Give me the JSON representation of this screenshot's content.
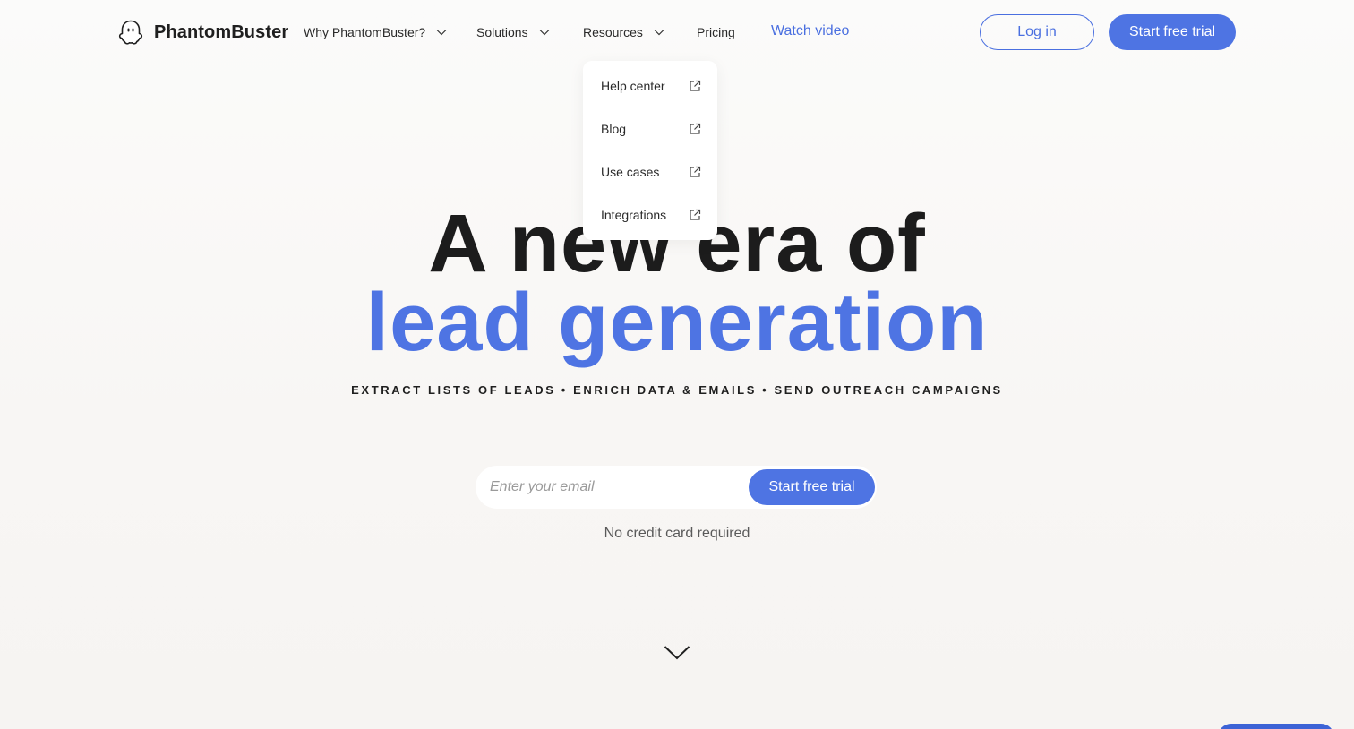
{
  "brand": {
    "name": "PhantomBuster",
    "icon": "ghost-logo-icon",
    "accent": "#4e74e3"
  },
  "nav": {
    "items": [
      {
        "label": "Why PhantomBuster?",
        "has_dropdown": true
      },
      {
        "label": "Solutions",
        "has_dropdown": true
      },
      {
        "label": "Resources",
        "has_dropdown": true
      },
      {
        "label": "Pricing",
        "has_dropdown": false
      }
    ],
    "watch_video": "Watch video",
    "login": "Log in",
    "start_trial": "Start free trial"
  },
  "resources_menu": {
    "items": [
      {
        "label": "Help center",
        "icon": "external-link-icon"
      },
      {
        "label": "Blog",
        "icon": "external-link-icon"
      },
      {
        "label": "Use cases",
        "icon": "external-link-icon"
      },
      {
        "label": "Integrations",
        "icon": "external-link-icon"
      }
    ]
  },
  "hero": {
    "line1": "A new era of",
    "line2": "lead generation",
    "subtitle": "EXTRACT LISTS OF LEADS • ENRICH DATA & EMAILS • SEND OUTREACH CAMPAIGNS"
  },
  "signup": {
    "email_placeholder": "Enter your email",
    "email_value": "",
    "button": "Start free trial",
    "note": "No credit card required"
  },
  "scroll_hint": {
    "icon": "chevron-down-icon"
  }
}
